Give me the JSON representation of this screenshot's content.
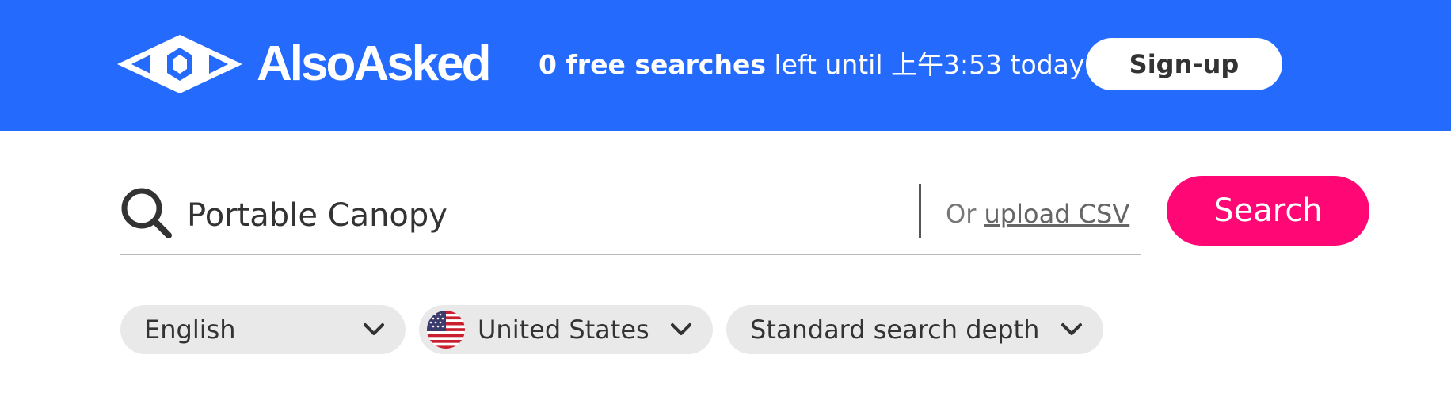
{
  "header": {
    "logo_text": "AlsoAsked",
    "free_count_bold": "0 free searches",
    "free_rest": " left until 上午3:53 today",
    "signup_label": "Sign-up"
  },
  "search": {
    "value": "Portable Canopy",
    "or_label": "Or ",
    "upload_label": "upload CSV",
    "button_label": "Search"
  },
  "filters": {
    "language": "English",
    "country": "United States",
    "depth": "Standard search depth"
  },
  "colors": {
    "header_bg": "#246bfd",
    "search_button": "#ff0775",
    "pill_bg": "#e9e9e9"
  },
  "icons": {
    "logo": "alsoasked-logo-icon",
    "search": "search-icon",
    "chevron": "chevron-down-icon",
    "flag": "us-flag-icon"
  }
}
